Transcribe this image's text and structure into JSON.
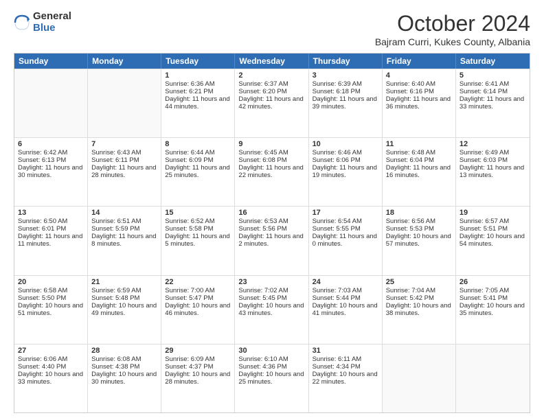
{
  "logo": {
    "general": "General",
    "blue": "Blue"
  },
  "title": "October 2024",
  "subtitle": "Bajram Curri, Kukes County, Albania",
  "days_of_week": [
    "Sunday",
    "Monday",
    "Tuesday",
    "Wednesday",
    "Thursday",
    "Friday",
    "Saturday"
  ],
  "weeks": [
    [
      {
        "day": "",
        "sunrise": "",
        "sunset": "",
        "daylight": "",
        "empty": true
      },
      {
        "day": "",
        "sunrise": "",
        "sunset": "",
        "daylight": "",
        "empty": true
      },
      {
        "day": "1",
        "sunrise": "Sunrise: 6:36 AM",
        "sunset": "Sunset: 6:21 PM",
        "daylight": "Daylight: 11 hours and 44 minutes."
      },
      {
        "day": "2",
        "sunrise": "Sunrise: 6:37 AM",
        "sunset": "Sunset: 6:20 PM",
        "daylight": "Daylight: 11 hours and 42 minutes."
      },
      {
        "day": "3",
        "sunrise": "Sunrise: 6:39 AM",
        "sunset": "Sunset: 6:18 PM",
        "daylight": "Daylight: 11 hours and 39 minutes."
      },
      {
        "day": "4",
        "sunrise": "Sunrise: 6:40 AM",
        "sunset": "Sunset: 6:16 PM",
        "daylight": "Daylight: 11 hours and 36 minutes."
      },
      {
        "day": "5",
        "sunrise": "Sunrise: 6:41 AM",
        "sunset": "Sunset: 6:14 PM",
        "daylight": "Daylight: 11 hours and 33 minutes."
      }
    ],
    [
      {
        "day": "6",
        "sunrise": "Sunrise: 6:42 AM",
        "sunset": "Sunset: 6:13 PM",
        "daylight": "Daylight: 11 hours and 30 minutes."
      },
      {
        "day": "7",
        "sunrise": "Sunrise: 6:43 AM",
        "sunset": "Sunset: 6:11 PM",
        "daylight": "Daylight: 11 hours and 28 minutes."
      },
      {
        "day": "8",
        "sunrise": "Sunrise: 6:44 AM",
        "sunset": "Sunset: 6:09 PM",
        "daylight": "Daylight: 11 hours and 25 minutes."
      },
      {
        "day": "9",
        "sunrise": "Sunrise: 6:45 AM",
        "sunset": "Sunset: 6:08 PM",
        "daylight": "Daylight: 11 hours and 22 minutes."
      },
      {
        "day": "10",
        "sunrise": "Sunrise: 6:46 AM",
        "sunset": "Sunset: 6:06 PM",
        "daylight": "Daylight: 11 hours and 19 minutes."
      },
      {
        "day": "11",
        "sunrise": "Sunrise: 6:48 AM",
        "sunset": "Sunset: 6:04 PM",
        "daylight": "Daylight: 11 hours and 16 minutes."
      },
      {
        "day": "12",
        "sunrise": "Sunrise: 6:49 AM",
        "sunset": "Sunset: 6:03 PM",
        "daylight": "Daylight: 11 hours and 13 minutes."
      }
    ],
    [
      {
        "day": "13",
        "sunrise": "Sunrise: 6:50 AM",
        "sunset": "Sunset: 6:01 PM",
        "daylight": "Daylight: 11 hours and 11 minutes."
      },
      {
        "day": "14",
        "sunrise": "Sunrise: 6:51 AM",
        "sunset": "Sunset: 5:59 PM",
        "daylight": "Daylight: 11 hours and 8 minutes."
      },
      {
        "day": "15",
        "sunrise": "Sunrise: 6:52 AM",
        "sunset": "Sunset: 5:58 PM",
        "daylight": "Daylight: 11 hours and 5 minutes."
      },
      {
        "day": "16",
        "sunrise": "Sunrise: 6:53 AM",
        "sunset": "Sunset: 5:56 PM",
        "daylight": "Daylight: 11 hours and 2 minutes."
      },
      {
        "day": "17",
        "sunrise": "Sunrise: 6:54 AM",
        "sunset": "Sunset: 5:55 PM",
        "daylight": "Daylight: 11 hours and 0 minutes."
      },
      {
        "day": "18",
        "sunrise": "Sunrise: 6:56 AM",
        "sunset": "Sunset: 5:53 PM",
        "daylight": "Daylight: 10 hours and 57 minutes."
      },
      {
        "day": "19",
        "sunrise": "Sunrise: 6:57 AM",
        "sunset": "Sunset: 5:51 PM",
        "daylight": "Daylight: 10 hours and 54 minutes."
      }
    ],
    [
      {
        "day": "20",
        "sunrise": "Sunrise: 6:58 AM",
        "sunset": "Sunset: 5:50 PM",
        "daylight": "Daylight: 10 hours and 51 minutes."
      },
      {
        "day": "21",
        "sunrise": "Sunrise: 6:59 AM",
        "sunset": "Sunset: 5:48 PM",
        "daylight": "Daylight: 10 hours and 49 minutes."
      },
      {
        "day": "22",
        "sunrise": "Sunrise: 7:00 AM",
        "sunset": "Sunset: 5:47 PM",
        "daylight": "Daylight: 10 hours and 46 minutes."
      },
      {
        "day": "23",
        "sunrise": "Sunrise: 7:02 AM",
        "sunset": "Sunset: 5:45 PM",
        "daylight": "Daylight: 10 hours and 43 minutes."
      },
      {
        "day": "24",
        "sunrise": "Sunrise: 7:03 AM",
        "sunset": "Sunset: 5:44 PM",
        "daylight": "Daylight: 10 hours and 41 minutes."
      },
      {
        "day": "25",
        "sunrise": "Sunrise: 7:04 AM",
        "sunset": "Sunset: 5:42 PM",
        "daylight": "Daylight: 10 hours and 38 minutes."
      },
      {
        "day": "26",
        "sunrise": "Sunrise: 7:05 AM",
        "sunset": "Sunset: 5:41 PM",
        "daylight": "Daylight: 10 hours and 35 minutes."
      }
    ],
    [
      {
        "day": "27",
        "sunrise": "Sunrise: 6:06 AM",
        "sunset": "Sunset: 4:40 PM",
        "daylight": "Daylight: 10 hours and 33 minutes."
      },
      {
        "day": "28",
        "sunrise": "Sunrise: 6:08 AM",
        "sunset": "Sunset: 4:38 PM",
        "daylight": "Daylight: 10 hours and 30 minutes."
      },
      {
        "day": "29",
        "sunrise": "Sunrise: 6:09 AM",
        "sunset": "Sunset: 4:37 PM",
        "daylight": "Daylight: 10 hours and 28 minutes."
      },
      {
        "day": "30",
        "sunrise": "Sunrise: 6:10 AM",
        "sunset": "Sunset: 4:36 PM",
        "daylight": "Daylight: 10 hours and 25 minutes."
      },
      {
        "day": "31",
        "sunrise": "Sunrise: 6:11 AM",
        "sunset": "Sunset: 4:34 PM",
        "daylight": "Daylight: 10 hours and 22 minutes."
      },
      {
        "day": "",
        "sunrise": "",
        "sunset": "",
        "daylight": "",
        "empty": true
      },
      {
        "day": "",
        "sunrise": "",
        "sunset": "",
        "daylight": "",
        "empty": true
      }
    ]
  ]
}
